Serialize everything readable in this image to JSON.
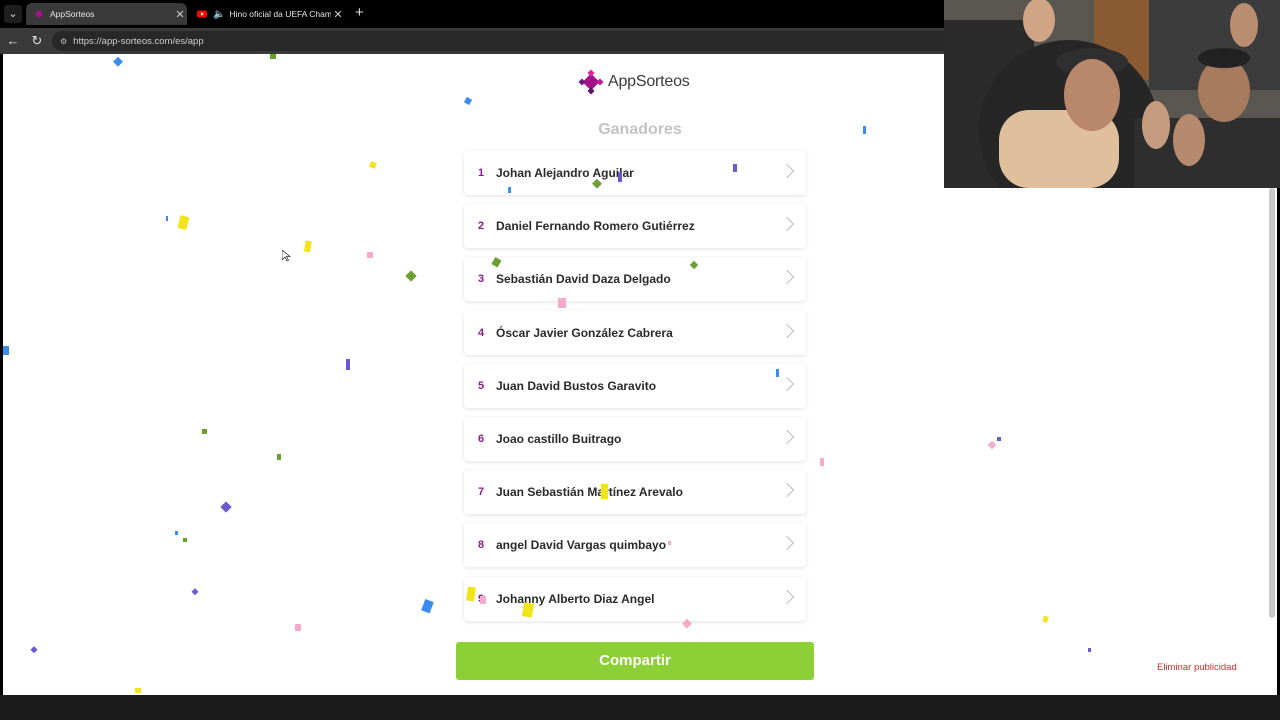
{
  "browser": {
    "tabs": [
      {
        "title": "AppSorteos",
        "active": true,
        "favicon": "appsorteos-favicon"
      },
      {
        "title": "Hino oficial da UEFA Champio",
        "active": false,
        "favicon": "youtube-favicon",
        "audio": true
      }
    ],
    "address": "https://app-sorteos.com/es/app"
  },
  "page": {
    "logo_text": "AppSorteos",
    "heading": "Ganadores",
    "winners": [
      {
        "num": "1",
        "name": "Johan Alejandro Aguilar"
      },
      {
        "num": "2",
        "name": "Daniel Fernando Romero Gutiérrez"
      },
      {
        "num": "3",
        "name": "Sebastián David Daza Delgado"
      },
      {
        "num": "4",
        "name": "Óscar Javier González Cabrera"
      },
      {
        "num": "5",
        "name": "Juan David Bustos Garavito"
      },
      {
        "num": "6",
        "name": "Joao castillo Buitrago"
      },
      {
        "num": "7",
        "name": "Juan Sebastián Martínez Arevalo"
      },
      {
        "num": "8",
        "name": "angel David Vargas quimbayo"
      },
      {
        "num": "9",
        "name": "Johanny Alberto Diaz Angel"
      }
    ],
    "share_label": "Compartir",
    "remove_ads": "Eliminar publicidad"
  },
  "colors": {
    "brand": "#a3128c",
    "share_button": "#8ccf36",
    "winner_number": "#8c1d8c",
    "remove_ads": "#cc2e2e"
  }
}
